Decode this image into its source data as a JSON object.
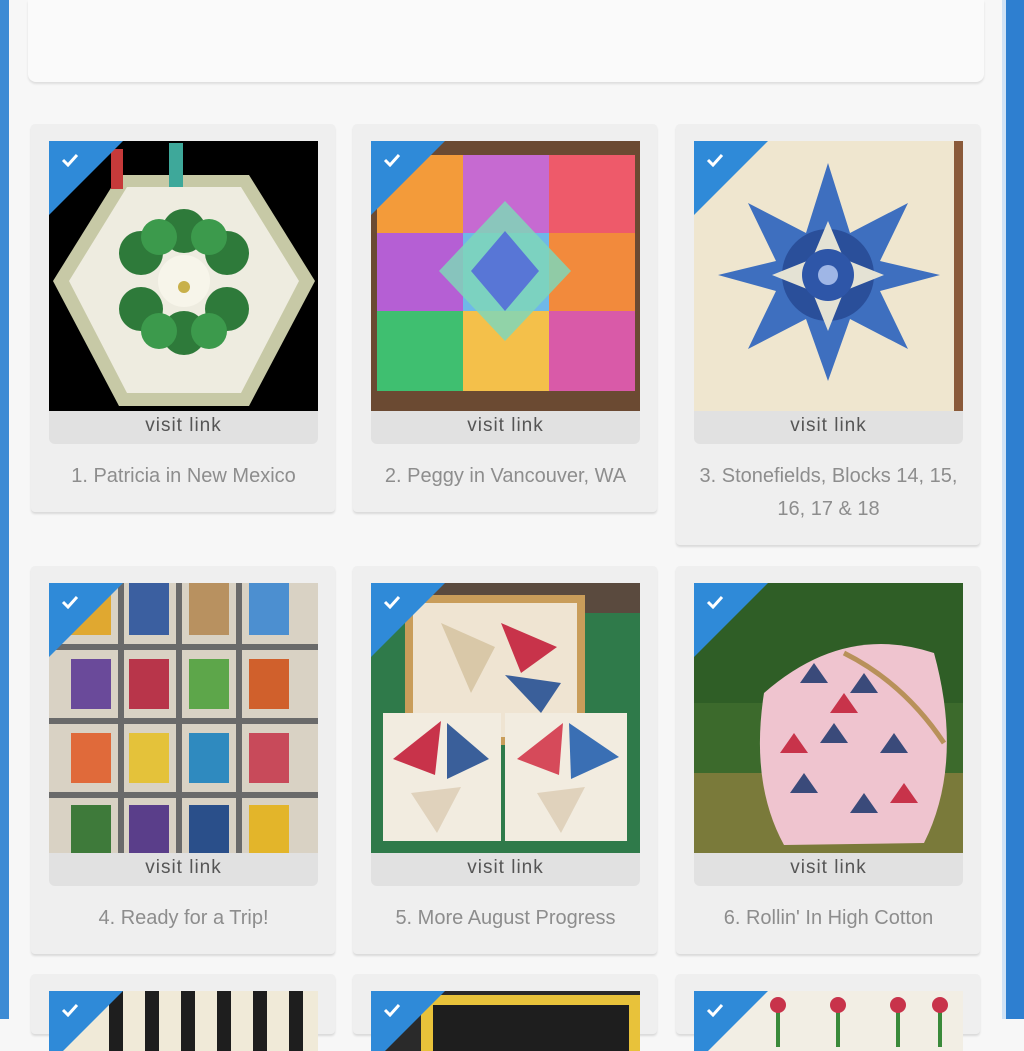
{
  "gallery": {
    "items": [
      {
        "visit_label": "visit link",
        "caption": "1. Patricia in New Mexico"
      },
      {
        "visit_label": "visit link",
        "caption": "2. Peggy in Vancouver, WA"
      },
      {
        "visit_label": "visit link",
        "caption": "3. Stonefields, Blocks 14, 15, 16, 17 & 18"
      },
      {
        "visit_label": "visit link",
        "caption": "4. Ready for a Trip!"
      },
      {
        "visit_label": "visit link",
        "caption": "5. More August Progress"
      },
      {
        "visit_label": "visit link",
        "caption": "6. Rollin' In High Cotton"
      }
    ]
  },
  "colors": {
    "accent": "#2f8ad8",
    "card_bg": "#efefef",
    "visit_bar": "#e1e1e1",
    "caption_text": "#8d8d8d"
  },
  "icons": {
    "selected": "check-icon"
  }
}
